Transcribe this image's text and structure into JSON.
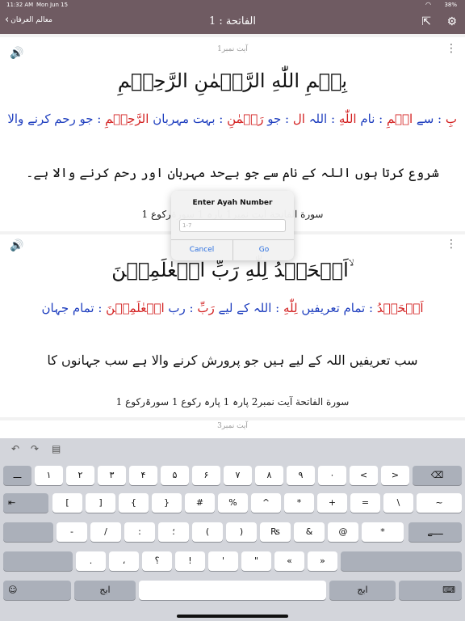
{
  "status": {
    "time": "11:32 AM",
    "date": "Mon Jun 15",
    "battery": "38%"
  },
  "nav": {
    "back_label": "معالم العرفان",
    "title": "الفاتحة : 1"
  },
  "ayahs": [
    {
      "label": "آیت نمبر1",
      "arabic": "بِسۡمِ اللّٰهِ الرَّحۡمٰنِ الرَّحِيۡمِ",
      "words": [
        {
          "ar": "بِ",
          "ur": "سے"
        },
        {
          "ar": "اسۡمِ",
          "ur": "نام"
        },
        {
          "ar": "اللّٰهِ",
          "ur": "اللہ"
        },
        {
          "ar": "ال",
          "ur": "جو"
        },
        {
          "ar": "رَحۡمٰنِ",
          "ur": "بہت مہربان"
        },
        {
          "ar": "الرَّحِيۡمِ",
          "ur": "جو رحم کرنے والا"
        }
      ],
      "translation": "شروع کرتا ہوں اللہ کے نام سے جو بےحد مہربان اور رحم کرنے والا ہے۔",
      "reference": "سورة الفاتحة آیت نمبر1 پارہ 1 سورۃرکوع 1"
    },
    {
      "label": "آیت نمبر2",
      "arabic": "اَلۡحَمۡدُ لِلّٰهِ رَبِّ الۡعٰلَمِيۡنَ ۙ",
      "words": [
        {
          "ar": "اَلۡحَمۡدُ",
          "ur": "تمام تعریفیں"
        },
        {
          "ar": "لِلّٰهِ",
          "ur": "اللہ کے لیے"
        },
        {
          "ar": "رَبِّ",
          "ur": "رب"
        },
        {
          "ar": "الۡعٰلَمِيۡنَ",
          "ur": "تمام جہان"
        }
      ],
      "translation": "سب تعریفیں اللہ کے لیے ہیں جو پرورش کرنے والا ہے سب جہانوں کا",
      "reference": "سورة الفاتحة آیت نمبر2 پارہ 1 پارہ رکوع 1 سورۃرکوع 1"
    },
    {
      "label": "آیت نمبر3"
    }
  ],
  "dialog": {
    "title": "Enter Ayah Number",
    "placeholder": "1-7",
    "cancel": "Cancel",
    "go": "Go"
  },
  "keyboard": {
    "row1": [
      "ـــ",
      "۱",
      "۲",
      "۳",
      "۴",
      "۵",
      "۶",
      "۷",
      "۸",
      "۹",
      "۰",
      "<",
      ">"
    ],
    "row2": [
      "[",
      "]",
      "{",
      "}",
      "#",
      "%",
      "^",
      "*",
      "+",
      "=",
      "\\",
      "~"
    ],
    "row3": [
      "-",
      "/",
      ":",
      "؛",
      "(",
      ")",
      "₨",
      "&",
      "@",
      "*",
      "ــــے"
    ],
    "row4": [
      ".",
      "،",
      "؟",
      "!",
      "'",
      "\"",
      "«",
      "»"
    ],
    "abc_left": "ابج",
    "abc_right": "ابج"
  }
}
